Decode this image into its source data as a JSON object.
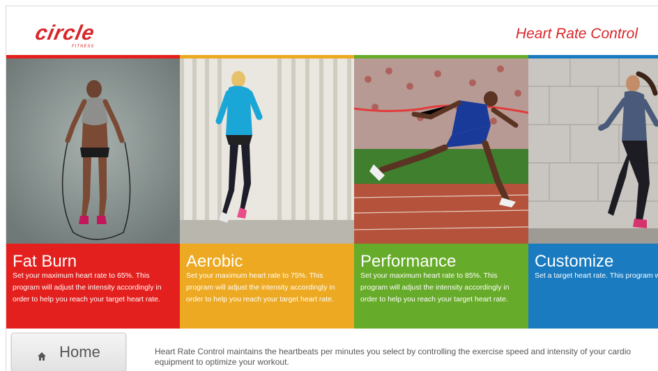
{
  "header": {
    "logo_text": "circle",
    "logo_subtext": "FITNESS",
    "title": "Heart Rate Control"
  },
  "programs": [
    {
      "title": "Fat Burn",
      "description": "Set your maximum heart rate to 65%. This program will adjust the intensity accordingly in order to help you reach your target heart rate.",
      "color": "#e3201e",
      "photo": "woman-jump-rope"
    },
    {
      "title": "Aerobic",
      "description": "Set your maximum heart rate to 75%. This program will adjust the intensity accordingly in order to help you reach your target heart rate.",
      "color": "#eda921",
      "photo": "woman-running-away"
    },
    {
      "title": "Performance",
      "description": "Set your maximum heart rate to 85%. This program will adjust the intensity accordingly in order to help you reach your target heart rate.",
      "color": "#67ab2a",
      "photo": "sprinter-finish-line"
    },
    {
      "title": "Customize",
      "description": "Set a target heart rate. This program will adjust the intensity level accordingly to help you reach your goal.",
      "color": "#1a7bc0",
      "photo": "woman-running-wall"
    }
  ],
  "footer": {
    "home_label": "Home",
    "home_icon": "home-icon",
    "info_text": "Heart Rate Control maintains the heartbeats per minutes you select by controlling the exercise speed and intensity of your cardio equipment to optimize your workout."
  }
}
